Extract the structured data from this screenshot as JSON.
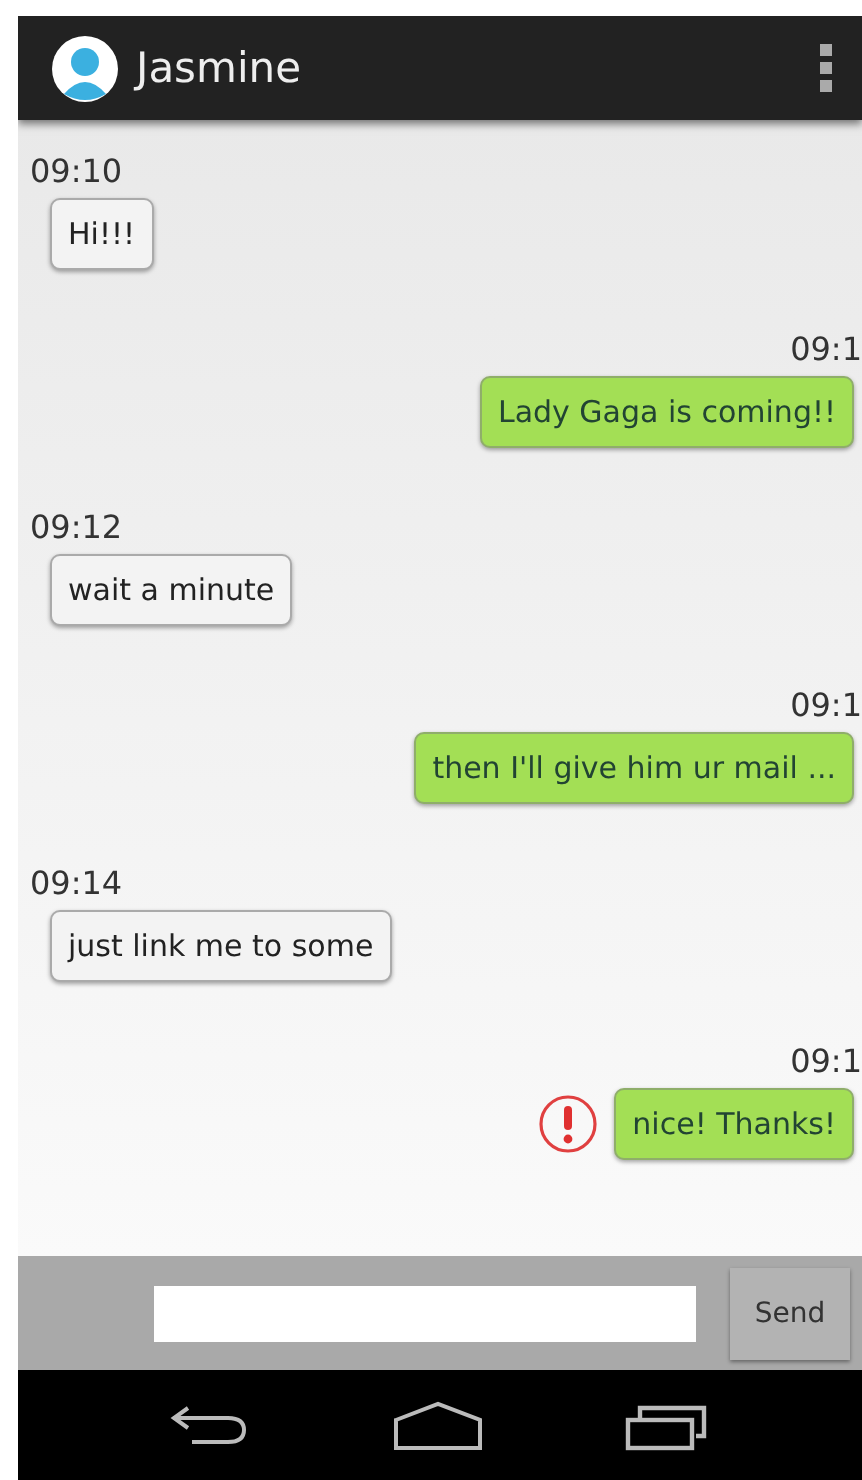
{
  "header": {
    "title": "Jasmine"
  },
  "messages": [
    {
      "time": "09:10",
      "text": "Hi!!!",
      "kind": "incoming",
      "failed": false
    },
    {
      "time": "09:1",
      "text": "Lady Gaga is coming!!",
      "kind": "outgoing",
      "failed": false
    },
    {
      "time": "09:12",
      "text": "wait a minute",
      "kind": "incoming",
      "failed": false
    },
    {
      "time": "09:1",
      "text": "then I'll give him ur mail ...",
      "kind": "outgoing",
      "failed": false
    },
    {
      "time": "09:14",
      "text": "just link me to some",
      "kind": "incoming",
      "failed": false
    },
    {
      "time": "09:1",
      "text": "nice! Thanks!",
      "kind": "outgoing",
      "failed": true
    }
  ],
  "composer": {
    "send_label": "Send"
  }
}
